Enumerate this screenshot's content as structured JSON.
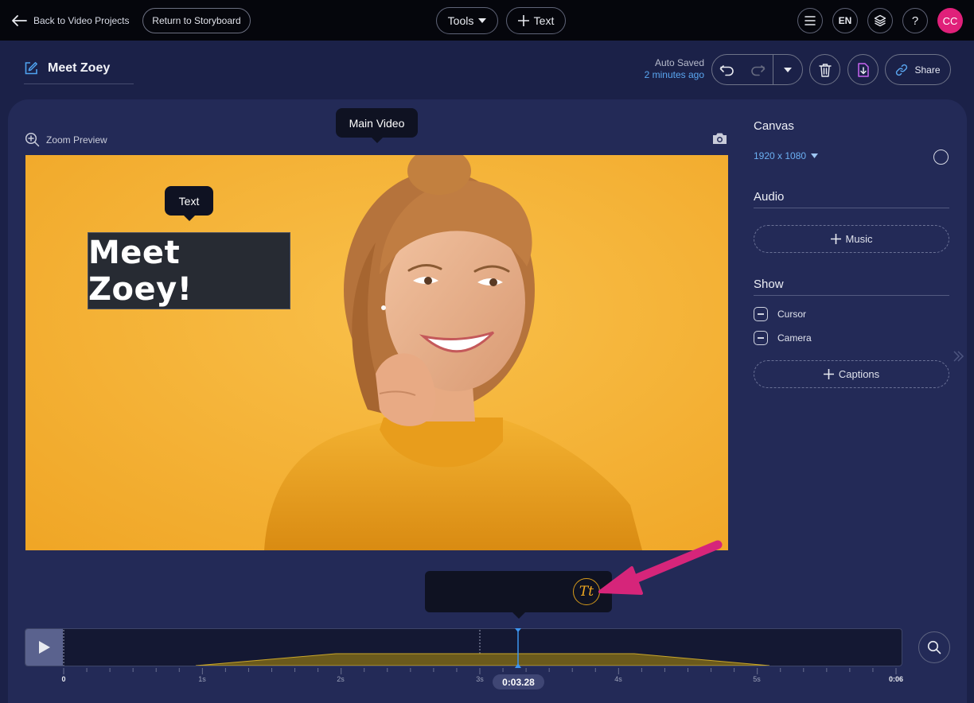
{
  "topbar": {
    "back_label": "Back to Video Projects",
    "storyboard_label": "Return to Storyboard",
    "lang_label": "EN",
    "help_label": "?",
    "avatar_initials": "CC"
  },
  "header": {
    "project_title": "Meet Zoey",
    "autosave_label": "Auto Saved",
    "autosave_time": "2 minutes ago",
    "share_label": "Share"
  },
  "preview": {
    "zoom_label": "Zoom Preview",
    "main_video_tooltip": "Main Video",
    "text_tooltip": "Text",
    "overlay_text": "Meet Zoey!"
  },
  "sidebar": {
    "canvas_heading": "Canvas",
    "canvas_size": "1920 x 1080",
    "audio_heading": "Audio",
    "music_label": "Music",
    "show_heading": "Show",
    "cursor_label": "Cursor",
    "camera_label": "Camera",
    "captions_label": "Captions"
  },
  "toolbar": {
    "tools_label": "Tools",
    "text_label": "Text",
    "text_style_label": "Tt"
  },
  "timeline": {
    "current_time": "0:03.28",
    "tick_labels": [
      "0",
      "1s",
      "2s",
      "3s",
      "4s",
      "5s",
      "0:06"
    ]
  },
  "colors": {
    "accent_blue": "#5aa6f0",
    "avatar_pink": "#e0207a",
    "annotation_arrow": "#d6257a",
    "text_style_gold": "#f0a820",
    "video_background": "#f5b02b"
  }
}
